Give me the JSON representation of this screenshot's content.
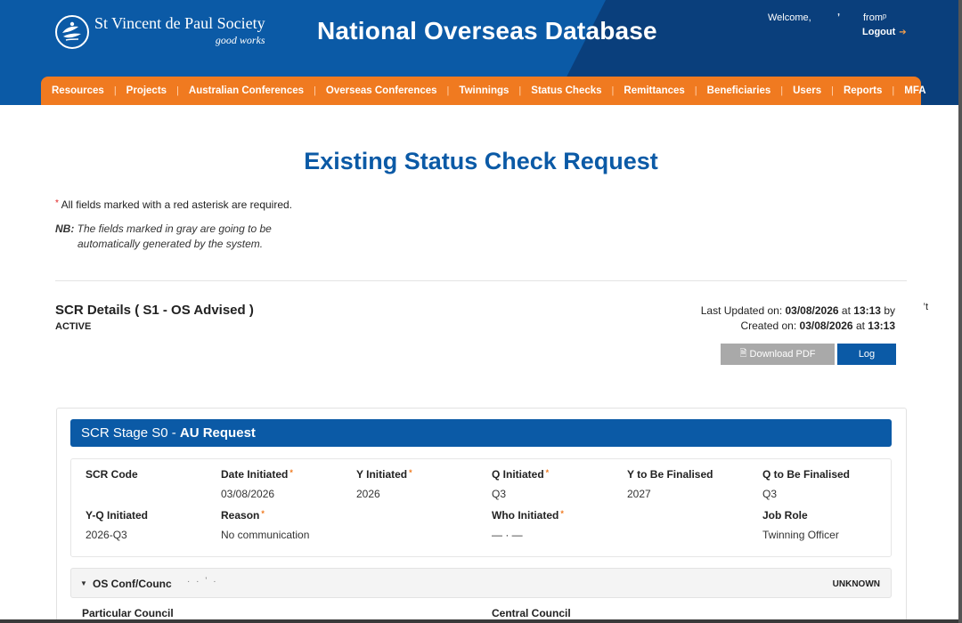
{
  "header": {
    "org_name": "St Vincent de Paul Society",
    "org_tagline": "good works",
    "app_title": "National Overseas Database",
    "welcome": "Welcome,",
    "user_mask_1": "ʼ",
    "user_mask_2": "fromᵖ",
    "logout": "Logout",
    "colors": {
      "primary": "#0b5aa6",
      "dark": "#0a3f7c",
      "accent": "#f07a20"
    }
  },
  "nav": {
    "items": [
      "Resources",
      "Projects",
      "Australian Conferences",
      "Overseas Conferences",
      "Twinnings",
      "Status Checks",
      "Remittances",
      "Beneficiaries",
      "Users",
      "Reports",
      "MFA"
    ]
  },
  "page": {
    "title": "Existing Status Check Request",
    "required_note": "All fields marked with a red asterisk are required.",
    "required_ast": "*",
    "nb_label": "NB:",
    "nb_line1": "The fields marked in gray are going to be",
    "nb_line2": "automatically generated by the system."
  },
  "scr": {
    "title": "SCR Details ( S1 - OS Advised )",
    "status": "ACTIVE",
    "last_updated_prefix": "Last Updated on:",
    "last_updated_date": "03/08/2026",
    "last_updated_at": "at",
    "last_updated_time": "13:13",
    "last_updated_by": "by",
    "last_updated_user_mask": "’t",
    "created_prefix": "Created on:",
    "created_date": "03/08/2026",
    "created_at": "at",
    "created_time": "13:13",
    "download_pdf": "Download PDF",
    "log": "Log"
  },
  "stage": {
    "prefix": "SCR Stage S0 -",
    "name": "AU Request",
    "fields": {
      "scr_code": {
        "label": "SCR Code",
        "value": " "
      },
      "date_initiated": {
        "label": "Date Initiated",
        "value": "03/08/2026"
      },
      "y_initiated": {
        "label": "Y Initiated",
        "value": "2026"
      },
      "q_initiated": {
        "label": "Q Initiated",
        "value": "Q3"
      },
      "y_to_be_finalised": {
        "label": "Y to Be Finalised",
        "value": "2027"
      },
      "q_to_be_finalised": {
        "label": "Q to Be Finalised",
        "value": "Q3"
      },
      "yq_initiated": {
        "label": "Y-Q Initiated",
        "value": "2026-Q3"
      },
      "reason": {
        "label": "Reason",
        "value": "No communication"
      },
      "who_initiated": {
        "label": "Who Initiated",
        "value": "— · —"
      },
      "job_role": {
        "label": "Job Role",
        "value": "Twinning Officer"
      }
    },
    "required_ast": "*"
  },
  "accordion": {
    "title": "OS Conf/Counc",
    "mask": "· · ʼ ·",
    "badge": "UNKNOWN",
    "particular_council": "Particular Council",
    "central_council": "Central Council"
  }
}
